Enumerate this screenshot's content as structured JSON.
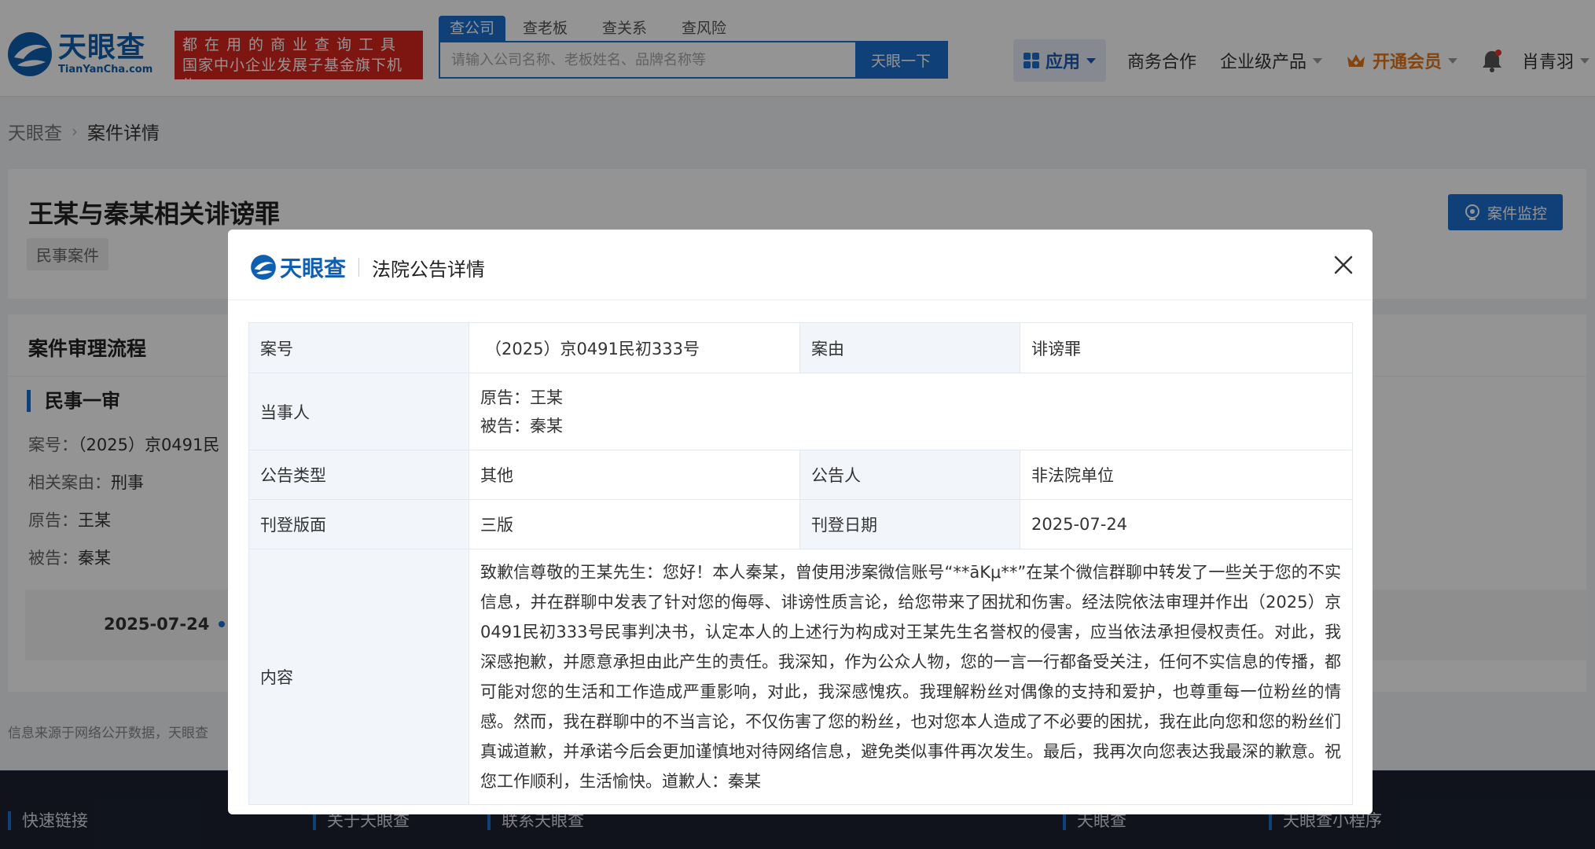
{
  "header": {
    "logo_cn": "天眼查",
    "logo_en": "TianYanCha.com",
    "slogan_line1": "都在用的商业查询工具",
    "slogan_line2": "国家中小企业发展子基金旗下机构",
    "search_tabs": [
      "查公司",
      "查老板",
      "查关系",
      "查风险"
    ],
    "search_placeholder": "请输入公司名称、老板姓名、品牌名称等",
    "search_button": "天眼一下",
    "nav_app": "应用",
    "nav_business": "商务合作",
    "nav_enterprise": "企业级产品",
    "nav_vip": "开通会员",
    "user_name": "肖青羽",
    "colors": {
      "brand": "#1b6fcf",
      "slogan_bg": "#d7261e",
      "vip": "#e4761c"
    }
  },
  "breadcrumb": {
    "home": "天眼查",
    "current": "案件详情"
  },
  "case": {
    "title": "王某与秦某相关诽谤罪",
    "tag": "民事案件",
    "monitor_button": "案件监控"
  },
  "flow": {
    "title": "案件审理流程",
    "stage": "民事一审",
    "case_no_label": "案号：",
    "case_no_partial": "（2025）京0491民",
    "related_label": "相关案由：",
    "related_value": "刑事",
    "plaintiff_label": "原告：",
    "plaintiff": "王某",
    "defendant_label": "被告：",
    "defendant": "秦某",
    "timeline_date": "2025-07-24"
  },
  "source_note": "信息来源于网络公开数据，天眼查",
  "footer": {
    "links": [
      "快速链接",
      "关于天眼查",
      "联系天眼查",
      "天眼查",
      "天眼查小程序"
    ]
  },
  "modal": {
    "brand": "天眼查",
    "title": "法院公告详情",
    "rows": {
      "case_no_key": "案号",
      "case_no": "（2025）京0491民初333号",
      "cause_key": "案由",
      "cause": "诽谤罪",
      "parties_key": "当事人",
      "plaintiff": "原告：王某",
      "defendant": "被告：秦某",
      "type_key": "公告类型",
      "type": "其他",
      "announcer_key": "公告人",
      "announcer": "非法院单位",
      "page_key": "刊登版面",
      "page": "三版",
      "date_key": "刊登日期",
      "date": "2025-07-24",
      "content_key": "内容",
      "content": "致歉信尊敬的王某先生：您好！本人秦某，曾使用涉案微信账号“**āKμ**”在某个微信群聊中转发了一些关于您的不实信息，并在群聊中发表了针对您的侮辱、诽谤性质言论，给您带来了困扰和伤害。经法院依法审理并作出（2025）京0491民初333号民事判决书，认定本人的上述行为构成对王某先生名誉权的侵害，应当依法承担侵权责任。对此，我深感抱歉，并愿意承担由此产生的责任。我深知，作为公众人物，您的一言一行都备受关注，任何不实信息的传播，都可能对您的生活和工作造成严重影响，对此，我深感愧疚。我理解粉丝对偶像的支持和爱护，也尊重每一位粉丝的情感。然而，我在群聊中的不当言论，不仅伤害了您的粉丝，也对您本人造成了不必要的困扰，我在此向您和您的粉丝们真诚道歉，并承诺今后会更加谨慎地对待网络信息，避免类似事件再次发生。最后，我再次向您表达我最深的歉意。祝您工作顺利，生活愉快。道歉人：秦某"
    }
  }
}
